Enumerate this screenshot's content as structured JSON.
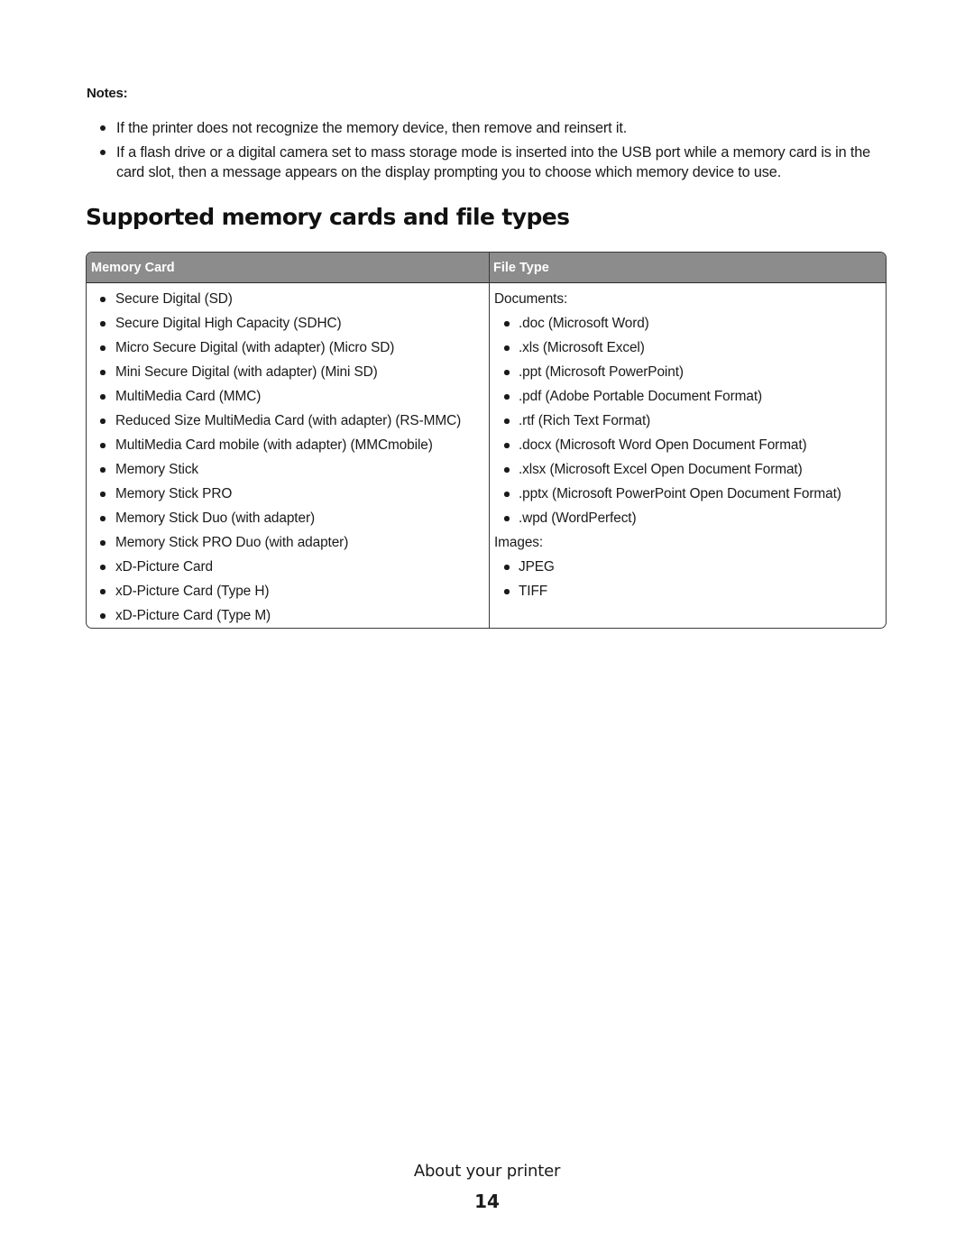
{
  "notes": {
    "label": "Notes:",
    "items": [
      "If the printer does not recognize the memory device, then remove and reinsert it.",
      "If a flash drive or a digital camera set to mass storage mode is inserted into the USB port while a memory card is in the card slot, then a message appears on the display prompting you to choose which memory device to use."
    ]
  },
  "section": {
    "title": "Supported memory cards and file types"
  },
  "table": {
    "headers": [
      "Memory Card",
      "File Type"
    ],
    "memory_cards": [
      "Secure Digital (SD)",
      "Secure Digital High Capacity (SDHC)",
      "Micro Secure Digital (with adapter) (Micro SD)",
      "Mini Secure Digital (with adapter) (Mini SD)",
      "MultiMedia Card (MMC)",
      "Reduced Size MultiMedia Card (with adapter) (RS-MMC)",
      "MultiMedia Card mobile (with adapter) (MMCmobile)",
      "Memory Stick",
      "Memory Stick PRO",
      "Memory Stick Duo (with adapter)",
      "Memory Stick PRO Duo (with adapter)",
      "xD-Picture Card",
      "xD-Picture Card (Type H)",
      "xD-Picture Card (Type M)"
    ],
    "file_types": {
      "documents_label": "Documents:",
      "documents": [
        ".doc (Microsoft Word)",
        ".xls (Microsoft Excel)",
        ".ppt (Microsoft PowerPoint)",
        ".pdf (Adobe Portable Document Format)",
        ".rtf (Rich Text Format)",
        ".docx (Microsoft Word Open Document Format)",
        ".xlsx (Microsoft Excel Open Document Format)",
        ".pptx (Microsoft PowerPoint Open Document Format)",
        ".wpd (WordPerfect)"
      ],
      "images_label": "Images:",
      "images": [
        "JPEG",
        "TIFF"
      ]
    }
  },
  "footer": {
    "section_name": "About your printer",
    "page_number": "14"
  },
  "colors": {
    "header_bg": "#8c8c8c",
    "header_text": "#ffffff",
    "text": "#1a1a1a",
    "border": "#3a3a3a"
  }
}
